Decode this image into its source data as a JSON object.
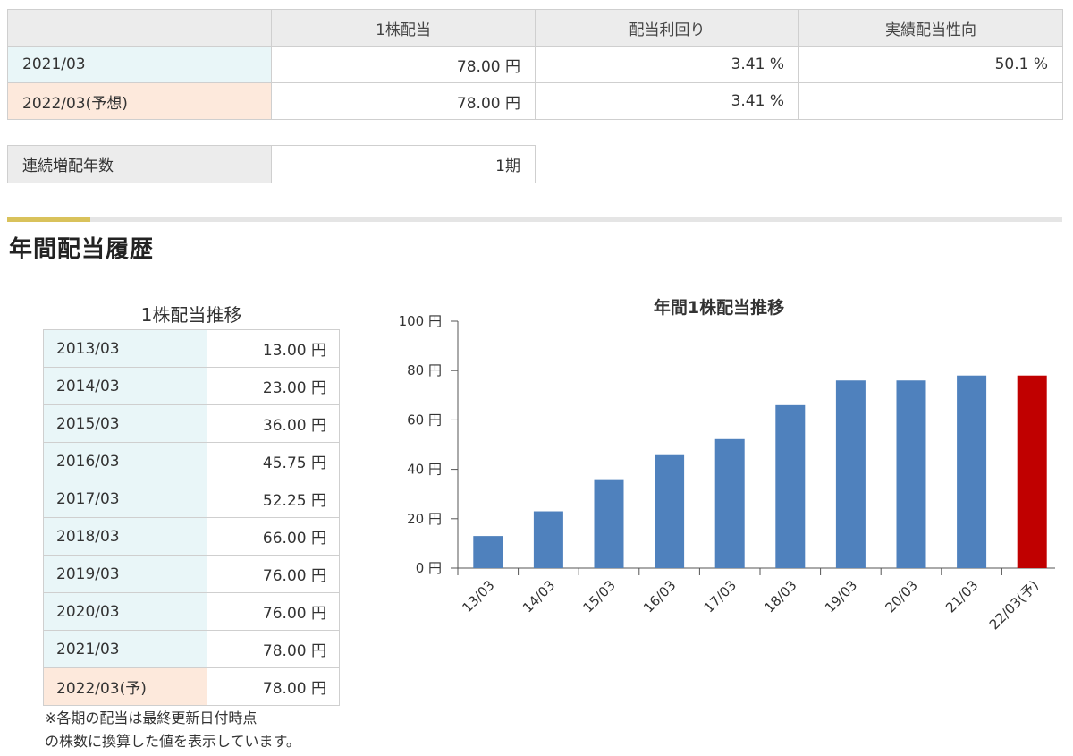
{
  "summary": {
    "headers": [
      "",
      "1株配当",
      "配当利回り",
      "実績配当性向"
    ],
    "rows": [
      {
        "period": "2021/03",
        "dividend": "78.00 円",
        "yield": "3.41 %",
        "payout": "50.1 %",
        "kind": "actual"
      },
      {
        "period": "2022/03(予想)",
        "dividend": "78.00 円",
        "yield": "3.41 %",
        "payout": "",
        "kind": "forecast"
      }
    ]
  },
  "streak": {
    "label": "連続増配年数",
    "value": "1期"
  },
  "section": {
    "title": "年間配当履歴"
  },
  "history": {
    "caption": "1株配当推移",
    "rows": [
      {
        "period": "2013/03",
        "value": "13.00 円",
        "kind": "actual"
      },
      {
        "period": "2014/03",
        "value": "23.00 円",
        "kind": "actual"
      },
      {
        "period": "2015/03",
        "value": "36.00 円",
        "kind": "actual"
      },
      {
        "period": "2016/03",
        "value": "45.75 円",
        "kind": "actual"
      },
      {
        "period": "2017/03",
        "value": "52.25 円",
        "kind": "actual"
      },
      {
        "period": "2018/03",
        "value": "66.00 円",
        "kind": "actual"
      },
      {
        "period": "2019/03",
        "value": "76.00 円",
        "kind": "actual"
      },
      {
        "period": "2020/03",
        "value": "76.00 円",
        "kind": "actual"
      },
      {
        "period": "2021/03",
        "value": "78.00 円",
        "kind": "actual"
      },
      {
        "period": "2022/03(予)",
        "value": "78.00 円",
        "kind": "forecast"
      }
    ],
    "note_lines": [
      "※各期の配当は最終更新日付時点",
      "の株数に換算した値を表示しています。"
    ]
  },
  "colors": {
    "bar_actual": "#4f81bd",
    "bar_forecast": "#c00000",
    "actual_bg": "#e9f6f8",
    "forecast_bg": "#fde9dc"
  },
  "chart_data": {
    "type": "bar",
    "title": "年間1株配当推移",
    "categories": [
      "13/03",
      "14/03",
      "15/03",
      "16/03",
      "17/03",
      "18/03",
      "19/03",
      "20/03",
      "21/03",
      "22/03(予)"
    ],
    "values": [
      13.0,
      23.0,
      36.0,
      45.75,
      52.25,
      66.0,
      76.0,
      76.0,
      78.0,
      78.0
    ],
    "forecast_flags": [
      false,
      false,
      false,
      false,
      false,
      false,
      false,
      false,
      false,
      true
    ],
    "ylim": [
      0,
      100
    ],
    "yticks": [
      0,
      20,
      40,
      60,
      80,
      100
    ],
    "ytick_labels": [
      "0 円",
      "20 円",
      "40 円",
      "60 円",
      "80 円",
      "100 円"
    ],
    "xlabel": "",
    "ylabel": "",
    "grid": false,
    "legend": "none"
  }
}
